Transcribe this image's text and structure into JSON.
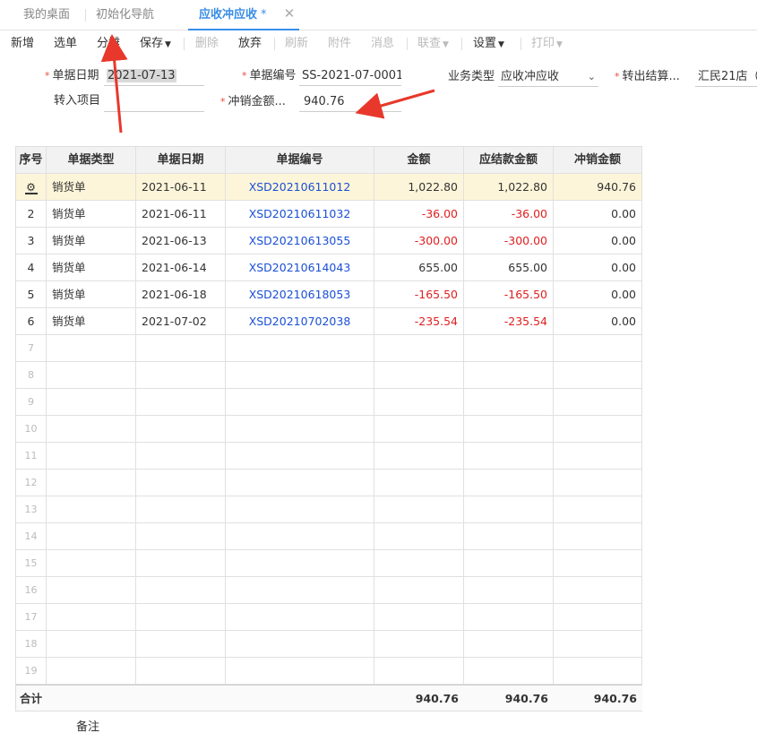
{
  "tabs": [
    {
      "label": "我的桌面"
    },
    {
      "label": "初始化导航"
    },
    {
      "label": "应收冲应收",
      "modified": "*"
    }
  ],
  "toolbar": {
    "new": "新增",
    "select": "选单",
    "split": "分摊",
    "save": "保存",
    "delete": "删除",
    "discard": "放弃",
    "refresh": "刷新",
    "attach": "附件",
    "message": "消息",
    "link_query": "联查",
    "settings": "设置",
    "print": "打印"
  },
  "form": {
    "date_label": "单据日期",
    "date_value": "2021-07-13",
    "number_label": "单据编号",
    "number_value": "SS-2021-07-0001",
    "biztype_label": "业务类型",
    "biztype_value": "应收冲应收",
    "transfer_out_label": "转出结算...",
    "transfer_out_value": "汇民21店（",
    "transfer_in_label": "转入项目",
    "transfer_in_value": "",
    "writeoff_label": "冲销金额...",
    "writeoff_value": "940.76"
  },
  "grid": {
    "headers": [
      "序号",
      "单据类型",
      "单据日期",
      "单据编号",
      "金额",
      "应结款金额",
      "冲销金额"
    ],
    "rows": [
      {
        "no": "",
        "type": "销货单",
        "date": "2021-06-11",
        "code": "XSD20210611012",
        "amount": "1,022.80",
        "due": "1,022.80",
        "writeoff": "940.76",
        "neg": false
      },
      {
        "no": "2",
        "type": "销货单",
        "date": "2021-06-11",
        "code": "XSD20210611032",
        "amount": "-36.00",
        "due": "-36.00",
        "writeoff": "0.00",
        "neg": true
      },
      {
        "no": "3",
        "type": "销货单",
        "date": "2021-06-13",
        "code": "XSD20210613055",
        "amount": "-300.00",
        "due": "-300.00",
        "writeoff": "0.00",
        "neg": true
      },
      {
        "no": "4",
        "type": "销货单",
        "date": "2021-06-14",
        "code": "XSD20210614043",
        "amount": "655.00",
        "due": "655.00",
        "writeoff": "0.00",
        "neg": false
      },
      {
        "no": "5",
        "type": "销货单",
        "date": "2021-06-18",
        "code": "XSD20210618053",
        "amount": "-165.50",
        "due": "-165.50",
        "writeoff": "0.00",
        "neg": true
      },
      {
        "no": "6",
        "type": "销货单",
        "date": "2021-07-02",
        "code": "XSD20210702038",
        "amount": "-235.54",
        "due": "-235.54",
        "writeoff": "0.00",
        "neg": true
      }
    ],
    "empty_rows": [
      "7",
      "8",
      "9",
      "10",
      "11",
      "12",
      "13",
      "14",
      "15",
      "16",
      "17",
      "18",
      "19"
    ],
    "total_label": "合计",
    "total_amount": "940.76",
    "total_due": "940.76",
    "total_writeoff": "940.76"
  },
  "remark_label": "备注",
  "colors": {
    "accent": "#3a8ee6",
    "negative": "#e02020",
    "link": "#1a4fd6",
    "arrow": "#e8382b"
  }
}
